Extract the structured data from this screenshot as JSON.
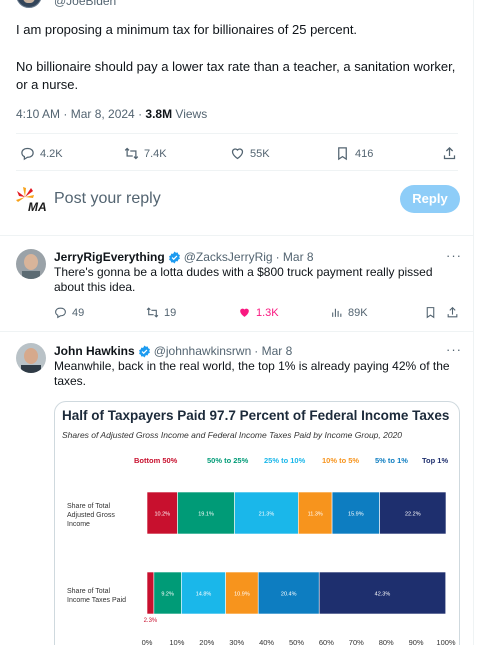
{
  "main_tweet": {
    "handle": "@JoeBiden",
    "text1": "I am proposing a minimum tax for billionaires of 25 percent.",
    "text2": "No billionaire should pay a lower tax rate than a teacher, a sanitation worker, or a nurse.",
    "time": "4:10 AM · Mar 8, 2024 · ",
    "views_count": "3.8M",
    "views_label": " Views",
    "replies": "4.2K",
    "reposts": "7.4K",
    "likes": "55K",
    "bookmarks": "416"
  },
  "reply_box": {
    "placeholder": "Post your reply",
    "button": "Reply"
  },
  "replies": [
    {
      "name": "JerryRigEverything",
      "handle": "@ZacksJerryRig",
      "date": "· Mar 8",
      "text": "There's gonna be a lotta dudes with a $800 truck payment really pissed about this idea.",
      "replies": "49",
      "reposts": "19",
      "likes": "1.3K",
      "views": "89K"
    },
    {
      "name": "John Hawkins",
      "handle": "@johnhawkinsrwn",
      "date": "· Mar 8",
      "text": "Meanwhile, back in the real world, the top 1% is already paying 42% of the taxes."
    }
  ],
  "colors": {
    "accent": "#1d9bf0",
    "like_pink": "#f91880",
    "reply_button_disabled": "#8ecdf8"
  },
  "chart_data": {
    "type": "bar",
    "title": "Half of Taxpayers Paid 97.7 Percent of Federal Income Taxes",
    "subtitle": "Shares of Adjusted Gross Income and Federal Income Taxes Paid by Income Group, 2020",
    "orientation": "horizontal-stacked",
    "legend": [
      {
        "name": "Bottom 50%",
        "color": "#c8102e"
      },
      {
        "name": "50% to 25%",
        "color": "#009b77"
      },
      {
        "name": "25% to 10%",
        "color": "#1ab7ea"
      },
      {
        "name": "10% to 5%",
        "color": "#f7941d"
      },
      {
        "name": "5% to 1%",
        "color": "#0d7dc1"
      },
      {
        "name": "Top 1%",
        "color": "#1e2f6e"
      }
    ],
    "categories": [
      "Share of Total Adjusted Gross Income",
      "Share of Total Income Taxes Paid"
    ],
    "series": [
      {
        "name": "Bottom 50%",
        "values": [
          10.2,
          2.3
        ]
      },
      {
        "name": "50% to 25%",
        "values": [
          19.1,
          9.2
        ]
      },
      {
        "name": "25% to 10%",
        "values": [
          21.3,
          14.8
        ]
      },
      {
        "name": "10% to 5%",
        "values": [
          11.3,
          10.9
        ]
      },
      {
        "name": "5% to 1%",
        "values": [
          15.9,
          20.4
        ]
      },
      {
        "name": "Top 1%",
        "values": [
          22.2,
          42.3
        ]
      }
    ],
    "xlim": [
      0,
      100
    ],
    "x_ticks": [
      "0%",
      "10%",
      "20%",
      "30%",
      "40%",
      "50%",
      "60%",
      "70%",
      "80%",
      "90%",
      "100%"
    ]
  }
}
